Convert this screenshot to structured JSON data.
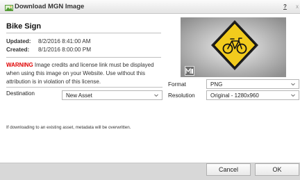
{
  "window": {
    "title": "Download MGN Image",
    "help_label": "?",
    "close_label": "x"
  },
  "asset": {
    "title": "Bike Sign",
    "updated_label": "Updated:",
    "updated_value": "8/2/2016 8:41:00 AM",
    "created_label": "Created:",
    "created_value": "8/1/2016 8:00:00 PM"
  },
  "warning": {
    "word": "WARNING",
    "text": " Image credits and license link must be displayed when using this image on your Website. Use without this attribution is in violation of this license."
  },
  "destination": {
    "label": "Destination",
    "value": "New Asset"
  },
  "note": "If downloading to an existing asset, metadata will be overwritten.",
  "format": {
    "label": "Format",
    "value": "PNG"
  },
  "resolution": {
    "label": "Resolution",
    "value": "Original - 1280x960"
  },
  "preview": {
    "icon": "bicycle-warning-sign-icon",
    "sign_color": "#f2cb1d"
  },
  "buttons": {
    "cancel": "Cancel",
    "ok": "OK"
  },
  "colors": {
    "warning": "#e00000",
    "footer": "#d8d8d8"
  }
}
